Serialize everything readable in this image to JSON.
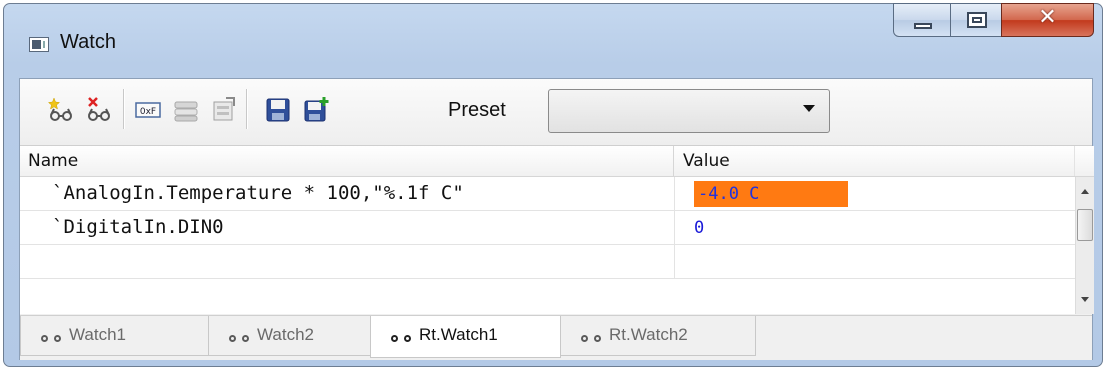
{
  "window": {
    "title": "Watch"
  },
  "toolbar": {
    "icons": [
      "add-watch-icon",
      "remove-watch-icon",
      "hex-format-icon",
      "stack-icon",
      "properties-icon",
      "save-icon",
      "save-as-icon"
    ],
    "preset_label": "Preset",
    "preset_value": ""
  },
  "grid": {
    "columns": [
      "Name",
      "Value"
    ],
    "rows": [
      {
        "name": "`AnalogIn.Temperature * 100,\"%.1f C\"",
        "value": "-4.0 C",
        "highlight": "#ff7a12"
      },
      {
        "name": "`DigitalIn.DIN0",
        "value": "0"
      },
      {
        "name": "",
        "value": ""
      }
    ]
  },
  "tabs": [
    {
      "label": "Watch1"
    },
    {
      "label": "Watch2"
    },
    {
      "label": "Rt.Watch1",
      "active": true
    },
    {
      "label": "Rt.Watch2"
    }
  ],
  "colors": {
    "value_text": "#1a1ad8",
    "highlight": "#ff7a12",
    "frame": "#b8cde8"
  }
}
